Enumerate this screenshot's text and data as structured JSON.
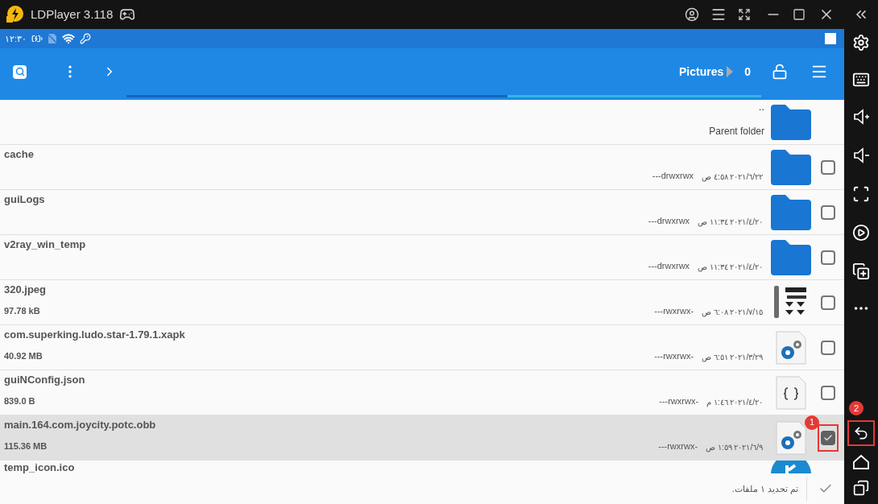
{
  "window": {
    "title": "LDPlayer 3.118"
  },
  "status_bar": {
    "time": "١٢:٣٠"
  },
  "toolbar": {
    "folder": "Pictures",
    "count": "0",
    "progress": {
      "level": 0.6
    }
  },
  "parent_row": {
    "name": "..",
    "label": "Parent folder"
  },
  "files": [
    {
      "name": "cache",
      "date": "٢٠٢١/٦/٢٢ ٤:٥٨ ص",
      "perms": "---drwxrwx",
      "kind": "folder",
      "selected": false
    },
    {
      "name": "guiLogs",
      "date": "٢٠٢١/٤/٢٠ ١١:٣٤ ص",
      "perms": "---drwxrwx",
      "kind": "folder",
      "selected": false
    },
    {
      "name": "v2ray_win_temp",
      "date": "٢٠٢١/٤/٢٠ ١١:٣٤ ص",
      "perms": "---drwxrwx",
      "kind": "folder",
      "selected": false
    },
    {
      "name": "320.jpeg",
      "size": "97.78 kB",
      "date": "٢٠٢١/٧/١٥ ٦:٠٨ ص",
      "perms": "---rwxrwx-",
      "selected": false
    },
    {
      "name": "com.superking.ludo.star-1.79.1.xapk",
      "size": "40.92 MB",
      "date": "٢٠٢١/٣/٢٩ ٦:٥١ ص",
      "perms": "---rwxrwx-",
      "kind": "package",
      "selected": false
    },
    {
      "name": "guiNConfig.json",
      "size": "839.0 B",
      "date": "٢٠٢١/٤/٢٠ ١:٤٦ م",
      "perms": "---rwxrwx-",
      "kind": "code",
      "selected": false
    },
    {
      "name": "main.164.com.joycity.potc.obb",
      "size": "115.36 MB",
      "date": "٢٠٢١/٦/٩ ١:٥٩ ص",
      "perms": "---rwxrwx-",
      "kind": "package",
      "selected": true,
      "badge": "1"
    },
    {
      "name": "temp_icon.ico",
      "kind": "ico"
    }
  ],
  "bottom_bar": {
    "message": "تم تحديد ١ ملفات."
  },
  "side_badge": "2"
}
